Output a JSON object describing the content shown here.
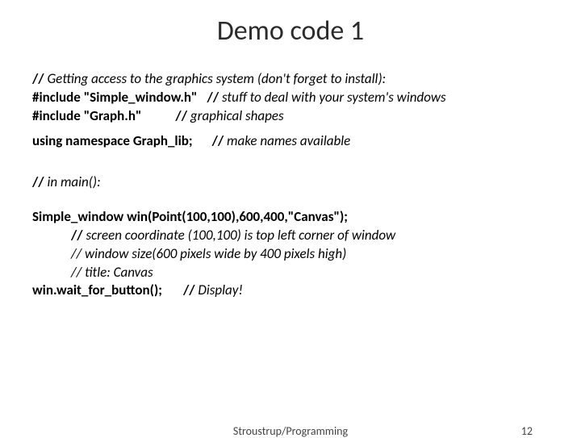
{
  "title": "Demo code 1",
  "block1": {
    "l1_b": "//",
    "l1_i": " Getting access to the graphics system (don't forget to install):",
    "l2_b1": "#include \"Simple_window.h\"",
    "l2_b2": "//",
    "l2_i": " stuff to deal with your system's windows",
    "l3_b1": "#include \"Graph.h\"",
    "l3_b2": "//",
    "l3_i": " graphical shapes",
    "l4_b1": "using namespace Graph_lib;",
    "l4_b2": "//",
    "l4_i": " make names available"
  },
  "block2": {
    "l1_b": "//",
    "l1_i": " in main():",
    "l3_b": "Simple_window win(Point(100,100),600,400,\"Canvas\");",
    "l4_b": "// ",
    "l4_i": "screen coordinate (100,100) is top left corner of window",
    "l5_i": "// window size(600 pixels wide by 400 pixels high)",
    "l6_i": "// title: Canvas",
    "l7_b1": "win.wait_for_button();",
    "l7_b2": "//",
    "l7_i": " Display!"
  },
  "footer": {
    "center": "Stroustrup/Programming",
    "pageno": "12"
  }
}
